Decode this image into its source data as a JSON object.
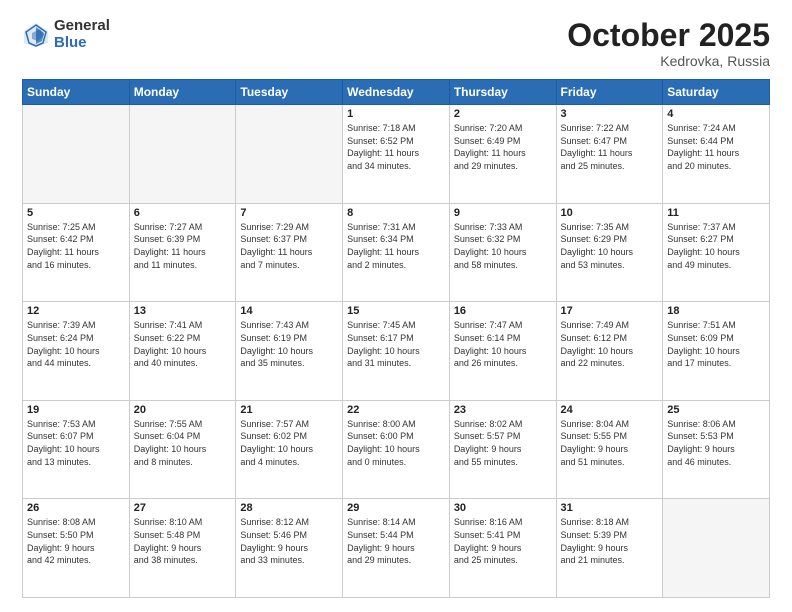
{
  "logo": {
    "general": "General",
    "blue": "Blue"
  },
  "header": {
    "month": "October 2025",
    "location": "Kedrovka, Russia"
  },
  "days_of_week": [
    "Sunday",
    "Monday",
    "Tuesday",
    "Wednesday",
    "Thursday",
    "Friday",
    "Saturday"
  ],
  "weeks": [
    [
      {
        "day": "",
        "info": ""
      },
      {
        "day": "",
        "info": ""
      },
      {
        "day": "",
        "info": ""
      },
      {
        "day": "1",
        "info": "Sunrise: 7:18 AM\nSunset: 6:52 PM\nDaylight: 11 hours\nand 34 minutes."
      },
      {
        "day": "2",
        "info": "Sunrise: 7:20 AM\nSunset: 6:49 PM\nDaylight: 11 hours\nand 29 minutes."
      },
      {
        "day": "3",
        "info": "Sunrise: 7:22 AM\nSunset: 6:47 PM\nDaylight: 11 hours\nand 25 minutes."
      },
      {
        "day": "4",
        "info": "Sunrise: 7:24 AM\nSunset: 6:44 PM\nDaylight: 11 hours\nand 20 minutes."
      }
    ],
    [
      {
        "day": "5",
        "info": "Sunrise: 7:25 AM\nSunset: 6:42 PM\nDaylight: 11 hours\nand 16 minutes."
      },
      {
        "day": "6",
        "info": "Sunrise: 7:27 AM\nSunset: 6:39 PM\nDaylight: 11 hours\nand 11 minutes."
      },
      {
        "day": "7",
        "info": "Sunrise: 7:29 AM\nSunset: 6:37 PM\nDaylight: 11 hours\nand 7 minutes."
      },
      {
        "day": "8",
        "info": "Sunrise: 7:31 AM\nSunset: 6:34 PM\nDaylight: 11 hours\nand 2 minutes."
      },
      {
        "day": "9",
        "info": "Sunrise: 7:33 AM\nSunset: 6:32 PM\nDaylight: 10 hours\nand 58 minutes."
      },
      {
        "day": "10",
        "info": "Sunrise: 7:35 AM\nSunset: 6:29 PM\nDaylight: 10 hours\nand 53 minutes."
      },
      {
        "day": "11",
        "info": "Sunrise: 7:37 AM\nSunset: 6:27 PM\nDaylight: 10 hours\nand 49 minutes."
      }
    ],
    [
      {
        "day": "12",
        "info": "Sunrise: 7:39 AM\nSunset: 6:24 PM\nDaylight: 10 hours\nand 44 minutes."
      },
      {
        "day": "13",
        "info": "Sunrise: 7:41 AM\nSunset: 6:22 PM\nDaylight: 10 hours\nand 40 minutes."
      },
      {
        "day": "14",
        "info": "Sunrise: 7:43 AM\nSunset: 6:19 PM\nDaylight: 10 hours\nand 35 minutes."
      },
      {
        "day": "15",
        "info": "Sunrise: 7:45 AM\nSunset: 6:17 PM\nDaylight: 10 hours\nand 31 minutes."
      },
      {
        "day": "16",
        "info": "Sunrise: 7:47 AM\nSunset: 6:14 PM\nDaylight: 10 hours\nand 26 minutes."
      },
      {
        "day": "17",
        "info": "Sunrise: 7:49 AM\nSunset: 6:12 PM\nDaylight: 10 hours\nand 22 minutes."
      },
      {
        "day": "18",
        "info": "Sunrise: 7:51 AM\nSunset: 6:09 PM\nDaylight: 10 hours\nand 17 minutes."
      }
    ],
    [
      {
        "day": "19",
        "info": "Sunrise: 7:53 AM\nSunset: 6:07 PM\nDaylight: 10 hours\nand 13 minutes."
      },
      {
        "day": "20",
        "info": "Sunrise: 7:55 AM\nSunset: 6:04 PM\nDaylight: 10 hours\nand 8 minutes."
      },
      {
        "day": "21",
        "info": "Sunrise: 7:57 AM\nSunset: 6:02 PM\nDaylight: 10 hours\nand 4 minutes."
      },
      {
        "day": "22",
        "info": "Sunrise: 8:00 AM\nSunset: 6:00 PM\nDaylight: 10 hours\nand 0 minutes."
      },
      {
        "day": "23",
        "info": "Sunrise: 8:02 AM\nSunset: 5:57 PM\nDaylight: 9 hours\nand 55 minutes."
      },
      {
        "day": "24",
        "info": "Sunrise: 8:04 AM\nSunset: 5:55 PM\nDaylight: 9 hours\nand 51 minutes."
      },
      {
        "day": "25",
        "info": "Sunrise: 8:06 AM\nSunset: 5:53 PM\nDaylight: 9 hours\nand 46 minutes."
      }
    ],
    [
      {
        "day": "26",
        "info": "Sunrise: 8:08 AM\nSunset: 5:50 PM\nDaylight: 9 hours\nand 42 minutes."
      },
      {
        "day": "27",
        "info": "Sunrise: 8:10 AM\nSunset: 5:48 PM\nDaylight: 9 hours\nand 38 minutes."
      },
      {
        "day": "28",
        "info": "Sunrise: 8:12 AM\nSunset: 5:46 PM\nDaylight: 9 hours\nand 33 minutes."
      },
      {
        "day": "29",
        "info": "Sunrise: 8:14 AM\nSunset: 5:44 PM\nDaylight: 9 hours\nand 29 minutes."
      },
      {
        "day": "30",
        "info": "Sunrise: 8:16 AM\nSunset: 5:41 PM\nDaylight: 9 hours\nand 25 minutes."
      },
      {
        "day": "31",
        "info": "Sunrise: 8:18 AM\nSunset: 5:39 PM\nDaylight: 9 hours\nand 21 minutes."
      },
      {
        "day": "",
        "info": ""
      }
    ]
  ]
}
